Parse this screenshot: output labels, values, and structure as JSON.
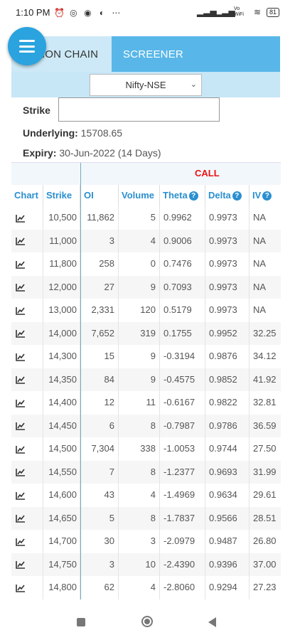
{
  "status_bar": {
    "time": "1:10 PM",
    "icons_left": [
      "alarm-icon",
      "whatsapp-icon",
      "chat-icon",
      "app-icon",
      "more-icon"
    ],
    "icons_right": [
      "signal-icon",
      "signal-icon",
      "vowifi-icon",
      "wifi-icon",
      "battery-icon"
    ],
    "vowifi": "Vo WiFi",
    "battery": "81"
  },
  "tabs": [
    {
      "label": "ION CHAIN",
      "active": true
    },
    {
      "label": "SCREENER",
      "active": false
    }
  ],
  "menu_button": {
    "icon": "menu-icon"
  },
  "exchange_select": {
    "value": "Nifty-NSE"
  },
  "strike": {
    "label": "Strike",
    "value": ""
  },
  "underlying": {
    "label": "Underlying:",
    "value": "15708.65"
  },
  "expiry": {
    "label": "Expiry:",
    "value": "30-Jun-2022 (14 Days)"
  },
  "table": {
    "section_label": "CALL",
    "section_color": "#e11111",
    "header_color": "#2a8fd0",
    "columns": [
      "Chart",
      "Strike",
      "OI",
      "Volume",
      "Theta",
      "Delta",
      "IV"
    ],
    "rows": [
      {
        "strike": "10,500",
        "oi": "11,862",
        "volume": "5",
        "theta": "0.9962",
        "delta": "0.9973",
        "iv": "NA"
      },
      {
        "strike": "11,000",
        "oi": "3",
        "volume": "4",
        "theta": "0.9006",
        "delta": "0.9973",
        "iv": "NA"
      },
      {
        "strike": "11,800",
        "oi": "258",
        "volume": "0",
        "theta": "0.7476",
        "delta": "0.9973",
        "iv": "NA"
      },
      {
        "strike": "12,000",
        "oi": "27",
        "volume": "9",
        "theta": "0.7093",
        "delta": "0.9973",
        "iv": "NA"
      },
      {
        "strike": "13,000",
        "oi": "2,331",
        "volume": "120",
        "theta": "0.5179",
        "delta": "0.9973",
        "iv": "NA"
      },
      {
        "strike": "14,000",
        "oi": "7,652",
        "volume": "319",
        "theta": "0.1755",
        "delta": "0.9952",
        "iv": "32.25"
      },
      {
        "strike": "14,300",
        "oi": "15",
        "volume": "9",
        "theta": "-0.3194",
        "delta": "0.9876",
        "iv": "34.12"
      },
      {
        "strike": "14,350",
        "oi": "84",
        "volume": "9",
        "theta": "-0.4575",
        "delta": "0.9852",
        "iv": "41.92"
      },
      {
        "strike": "14,400",
        "oi": "12",
        "volume": "11",
        "theta": "-0.6167",
        "delta": "0.9822",
        "iv": "32.81"
      },
      {
        "strike": "14,450",
        "oi": "6",
        "volume": "8",
        "theta": "-0.7987",
        "delta": "0.9786",
        "iv": "36.59"
      },
      {
        "strike": "14,500",
        "oi": "7,304",
        "volume": "338",
        "theta": "-1.0053",
        "delta": "0.9744",
        "iv": "27.50"
      },
      {
        "strike": "14,550",
        "oi": "7",
        "volume": "8",
        "theta": "-1.2377",
        "delta": "0.9693",
        "iv": "31.99"
      },
      {
        "strike": "14,600",
        "oi": "43",
        "volume": "4",
        "theta": "-1.4969",
        "delta": "0.9634",
        "iv": "29.61"
      },
      {
        "strike": "14,650",
        "oi": "5",
        "volume": "8",
        "theta": "-1.7837",
        "delta": "0.9566",
        "iv": "28.51"
      },
      {
        "strike": "14,700",
        "oi": "30",
        "volume": "3",
        "theta": "-2.0979",
        "delta": "0.9487",
        "iv": "26.80"
      },
      {
        "strike": "14,750",
        "oi": "3",
        "volume": "10",
        "theta": "-2.4390",
        "delta": "0.9396",
        "iv": "37.00"
      },
      {
        "strike": "14,800",
        "oi": "62",
        "volume": "4",
        "theta": "-2.8060",
        "delta": "0.9294",
        "iv": "27.23"
      }
    ]
  },
  "nav_bar": {
    "icons": [
      "recents-icon",
      "home-icon",
      "back-icon"
    ]
  }
}
